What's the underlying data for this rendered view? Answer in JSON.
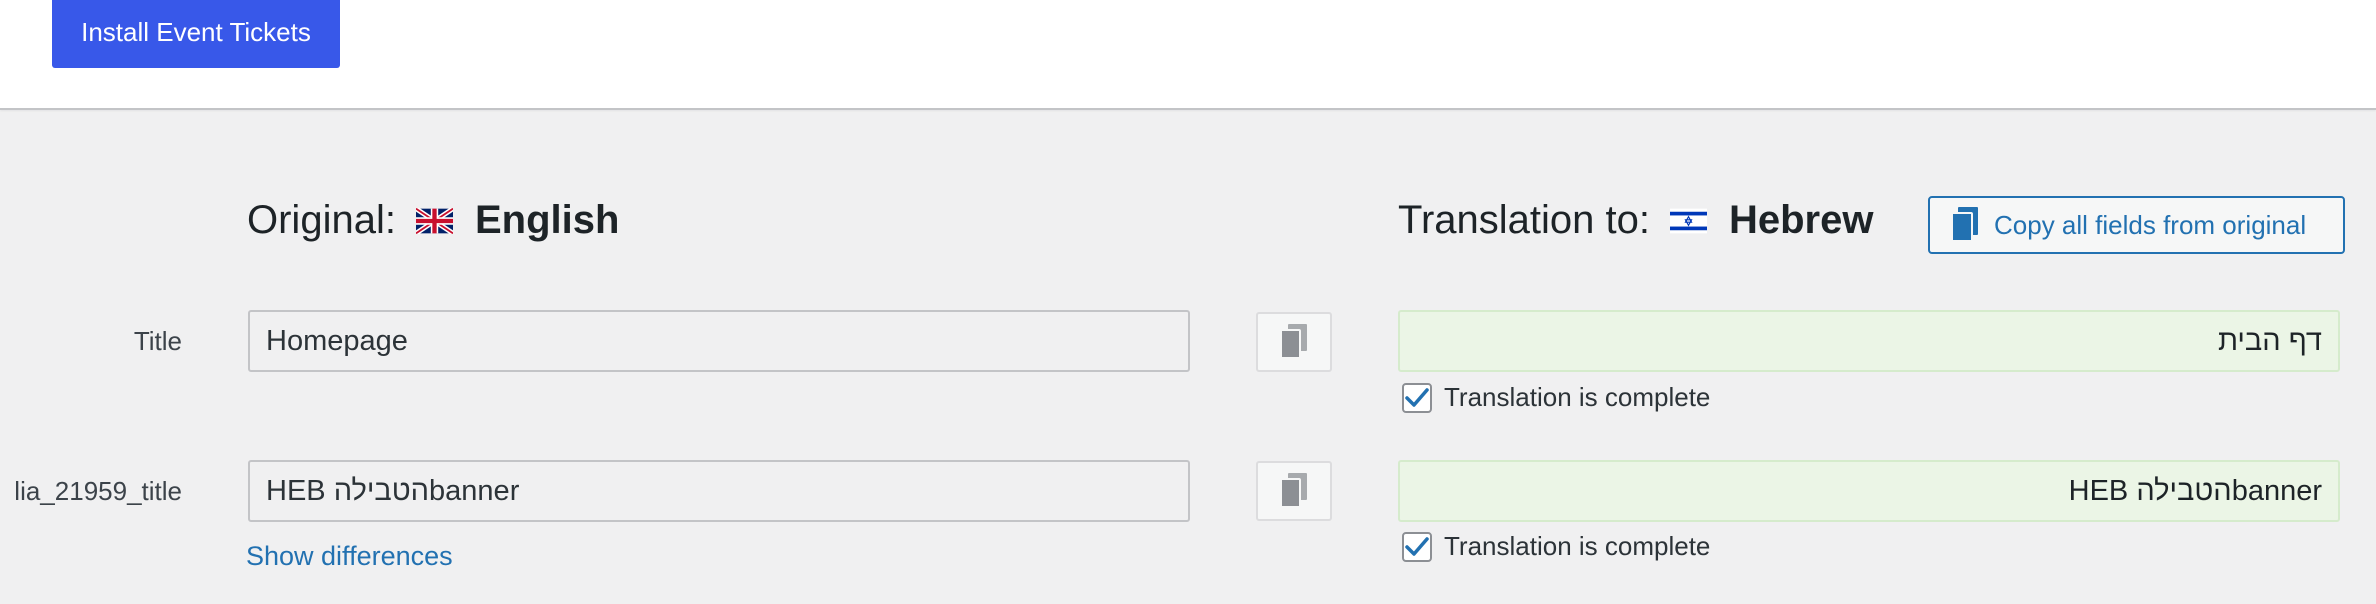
{
  "header": {
    "install_button_label": "Install Event Tickets"
  },
  "original": {
    "prefix": "Original:",
    "language": "English",
    "flag_icon": "uk-flag-icon"
  },
  "translation": {
    "prefix": "Translation to:",
    "language": "Hebrew",
    "flag_icon": "israel-flag-icon",
    "copy_all_label": "Copy all fields from original"
  },
  "fields": [
    {
      "label": "Title",
      "original_value": "Homepage",
      "translated_value": "דף הבית",
      "complete_label": "Translation is complete",
      "complete_checked": true
    },
    {
      "label": "lia_21959_title",
      "original_value": "HEB הטבילהbanner",
      "translated_value": "HEB הטבילהbanner",
      "complete_label": "Translation is complete",
      "complete_checked": true,
      "show_differences_label": "Show differences"
    }
  ],
  "colors": {
    "primary_button": "#3858e9",
    "link": "#2271b1",
    "translated_bg": "#ebf5e6",
    "page_bg": "#f0f0f1"
  }
}
